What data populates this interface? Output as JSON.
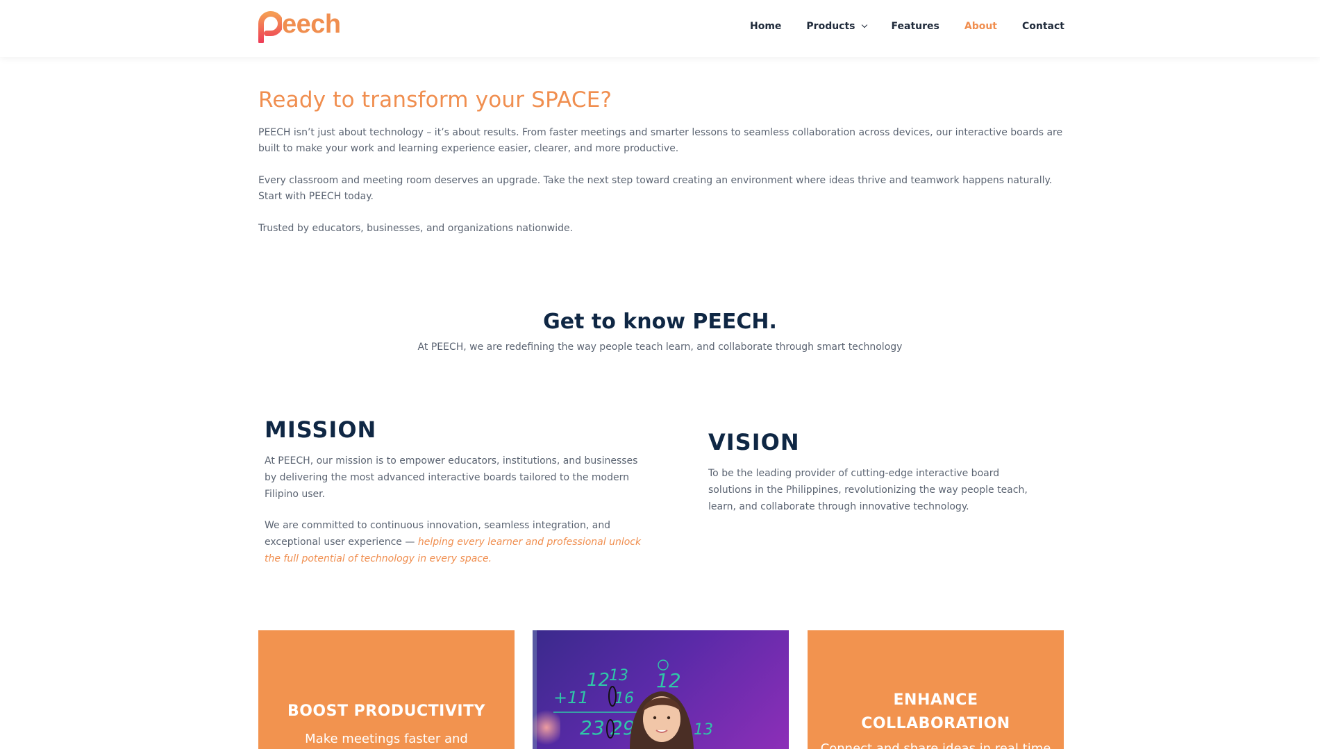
{
  "brand": {
    "logo_text": "eech",
    "logo_initial": "P",
    "accent": "#f08e4f",
    "navy": "#0f2744"
  },
  "nav": {
    "items": [
      {
        "label": "Home",
        "active": false,
        "has_dropdown": false
      },
      {
        "label": "Products",
        "active": false,
        "has_dropdown": true
      },
      {
        "label": "Features",
        "active": false,
        "has_dropdown": false
      },
      {
        "label": "About",
        "active": true,
        "has_dropdown": false
      },
      {
        "label": "Contact",
        "active": false,
        "has_dropdown": false
      }
    ]
  },
  "hero": {
    "title": "Ready to transform your SPACE?",
    "p1": "PEECH isn’t just about technology – it’s about results. From faster meetings and smarter lessons to seamless collaboration across devices, our interactive boards are built to make your work and learning experience easier, clearer, and more productive.",
    "p2": "Every classroom and meeting room deserves an upgrade. Take the next step toward creating an environment where ideas thrive and teamwork happens naturally. Start with PEECH today.",
    "p3": "Trusted by educators, businesses, and organizations nationwide."
  },
  "about": {
    "title": "Get to know PEECH.",
    "subtitle": "At PEECH, we are redefining the way people teach learn, and collaborate through smart technology"
  },
  "mission": {
    "title": "MISSION",
    "p1": "At PEECH, our mission is to empower educators, institutions, and businesses by delivering the most advanced interactive boards tailored to the modern Filipino user.",
    "p2_plain": "We are committed to continuous innovation, seamless integration, and exceptional user experience — ",
    "p2_emphasis": "helping every learner and professional unlock the full potential of technology in every space."
  },
  "vision": {
    "title": "VISION",
    "p": "To be the leading provider of cutting-edge interactive board solutions in the Philippines, revolutionizing the way people teach, learn, and collaborate through innovative technology."
  },
  "cards": [
    {
      "title": "BOOST PRODUCTIVITY",
      "text": "Make meetings faster and"
    },
    {
      "image_alt": "Student at interactive whiteboard with math equations",
      "board_text": [
        "12",
        "13",
        "12",
        "+11",
        "16",
        "23",
        "29",
        "13"
      ]
    },
    {
      "title_line1": "ENHANCE",
      "title_line2": "COLLABORATION",
      "text": "Connect and share ideas in real time"
    }
  ]
}
